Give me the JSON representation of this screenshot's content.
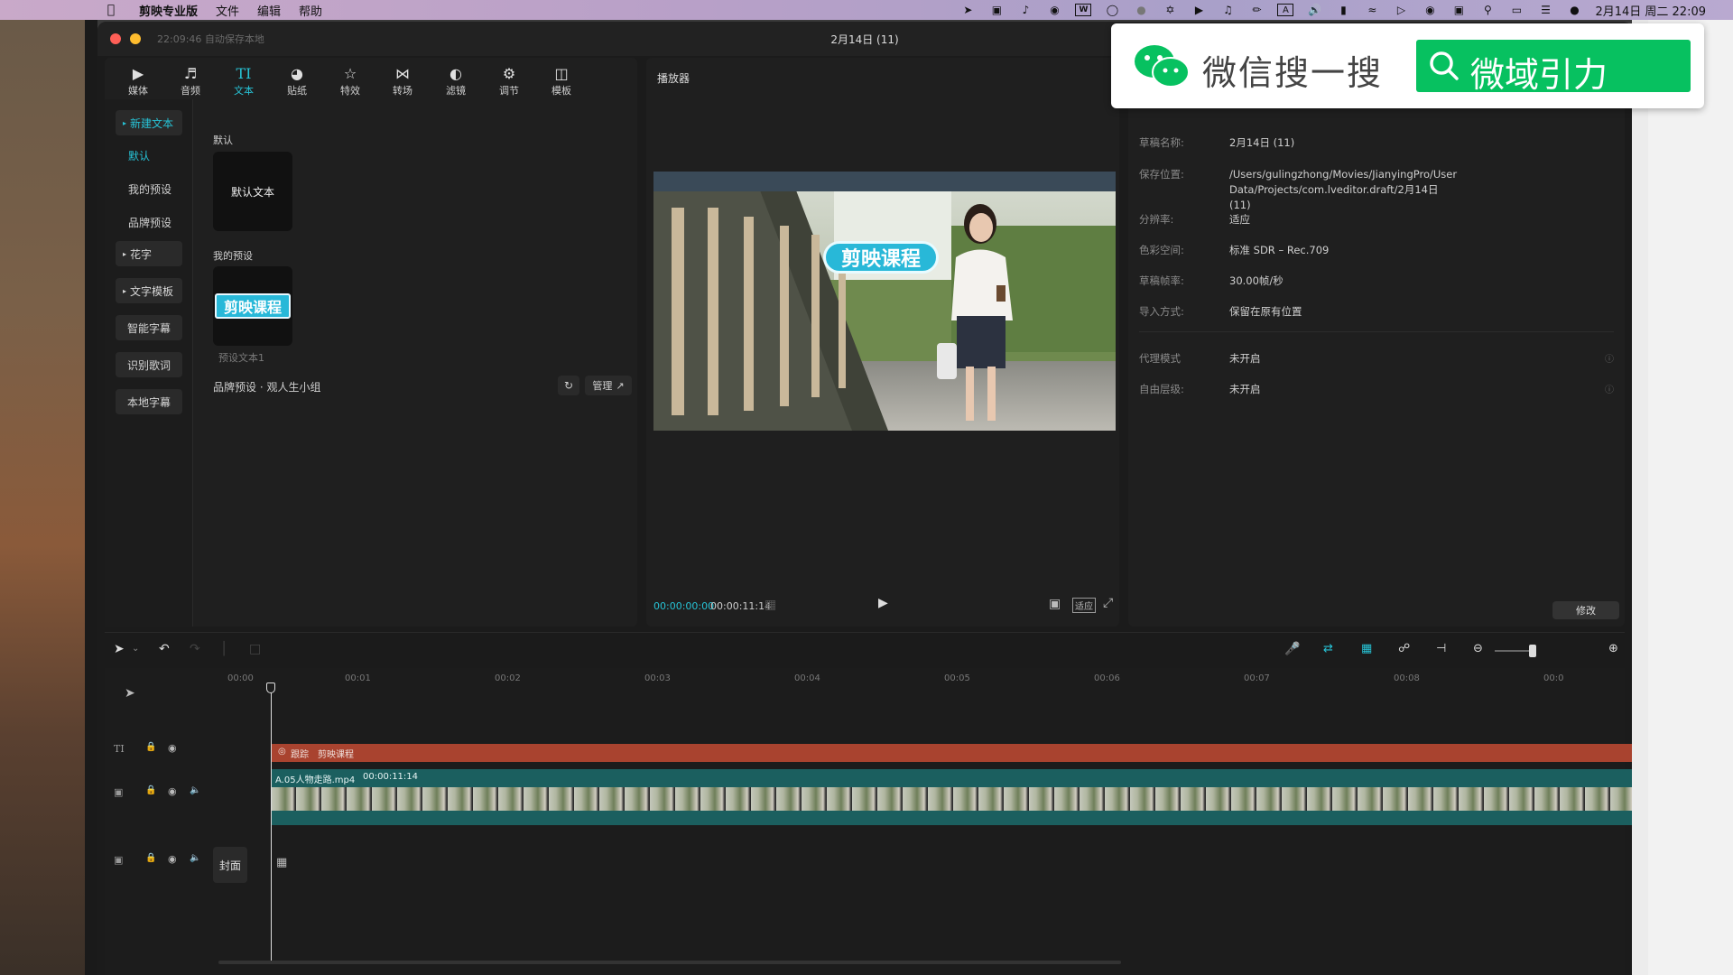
{
  "menubar": {
    "app_name": "剪映专业版",
    "menus": [
      "文件",
      "编辑",
      "帮助"
    ],
    "clock": "2月14日 周二 22:09",
    "icons": [
      "location-icon",
      "screen-record-icon",
      "tiktok-icon",
      "chrome-icon",
      "wps-icon",
      "circle-icon",
      "dot-icon",
      "fan-icon",
      "app-icon",
      "bell-icon",
      "pen-icon",
      "input-a-icon",
      "volume-icon",
      "battery-icon",
      "wifi-icon",
      "play-circle-icon",
      "wechat-icon",
      "photo-icon",
      "search-icon",
      "screen-icon",
      "control-center-icon",
      "siri-icon"
    ],
    "input_method": "A"
  },
  "window": {
    "autosave": "22:09:46 自动保存本地",
    "title": "2月14日 (11)"
  },
  "toolbar": {
    "items": [
      {
        "label": "媒体",
        "icon": "media-icon"
      },
      {
        "label": "音频",
        "icon": "audio-icon"
      },
      {
        "label": "文本",
        "icon": "text-icon"
      },
      {
        "label": "贴纸",
        "icon": "sticker-icon"
      },
      {
        "label": "特效",
        "icon": "effects-icon"
      },
      {
        "label": "转场",
        "icon": "transition-icon"
      },
      {
        "label": "滤镜",
        "icon": "filter-icon"
      },
      {
        "label": "调节",
        "icon": "adjust-icon"
      },
      {
        "label": "模板",
        "icon": "template-icon"
      }
    ],
    "active_index": 2
  },
  "text_sidebar": {
    "new_text": "新建文本",
    "default": "默认",
    "my_presets": "我的预设",
    "brand_presets": "品牌预设",
    "fancy_text": "花字",
    "text_templates": "文字模板",
    "smart_subtitle": "智能字幕",
    "lyrics": "识别歌词",
    "local_subtitle": "本地字幕"
  },
  "text_content": {
    "section_default": "默认",
    "default_card": "默认文本",
    "section_my_presets": "我的预设",
    "preset_card": "剪映课程",
    "preset_caption": "预设文本1",
    "brand_row": "品牌预设 · 观人生小组",
    "manage_button": "管理"
  },
  "player": {
    "title": "播放器",
    "overlay_text": "剪映课程",
    "current_time": "00:00:00:00",
    "total_time": "00:00:11:14",
    "ratio_button": "适应",
    "accent": "#27c3d6"
  },
  "properties": {
    "rows": [
      {
        "key": "草稿名称:",
        "value": "2月14日 (11)"
      },
      {
        "key": "保存位置:",
        "value": "/Users/gulingzhong/Movies/JianyingPro/User Data/Projects/com.lveditor.draft/2月14日 (11)"
      },
      {
        "key": "分辨率:",
        "value": "适应"
      },
      {
        "key": "色彩空间:",
        "value": "标准 SDR – Rec.709"
      },
      {
        "key": "草稿帧率:",
        "value": "30.00帧/秒"
      },
      {
        "key": "导入方式:",
        "value": "保留在原有位置"
      },
      {
        "key": "代理模式",
        "value": "未开启"
      },
      {
        "key": "自由层级:",
        "value": "未开启"
      }
    ],
    "edit_button": "修改"
  },
  "wechat": {
    "label": "微信搜一搜",
    "search_text": "微域引力",
    "brand_color": "#07c160"
  },
  "timeline": {
    "ruler": [
      "00:00",
      "00:01",
      "00:02",
      "00:03",
      "00:04",
      "00:05",
      "00:06",
      "00:07",
      "00:08",
      "00:0"
    ],
    "text_clip": {
      "tag": "跟踪",
      "label": "剪映课程",
      "color": "#a9432f"
    },
    "video_clip": {
      "label": "A.05人物走路.mp4",
      "duration": "00:00:11:14",
      "color": "#1b5f5f"
    },
    "cover": "封面"
  }
}
